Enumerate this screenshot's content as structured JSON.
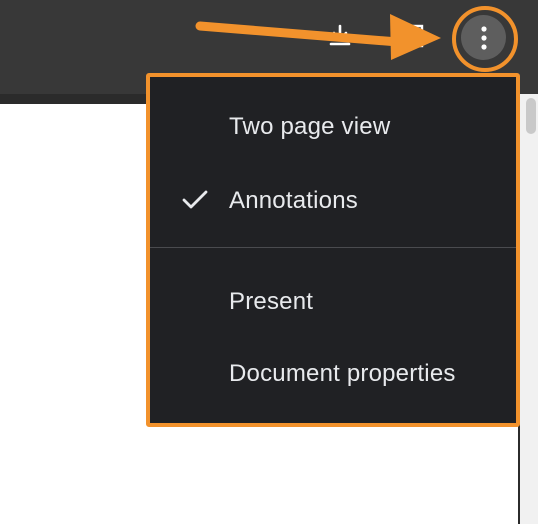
{
  "toolbar": {
    "download_icon": "download-icon",
    "print_icon": "print-icon",
    "more_icon": "more-vert-icon",
    "background": "#383838"
  },
  "menu": {
    "items": [
      {
        "label": "Two page view",
        "checked": false
      },
      {
        "label": "Annotations",
        "checked": true
      },
      {
        "label": "Present",
        "checked": false
      },
      {
        "label": "Document properties",
        "checked": false
      }
    ],
    "background": "#202124",
    "text_color": "#e8eaed"
  },
  "annotation": {
    "highlight_color": "#f2922c",
    "arrow_color": "#f2922c"
  }
}
